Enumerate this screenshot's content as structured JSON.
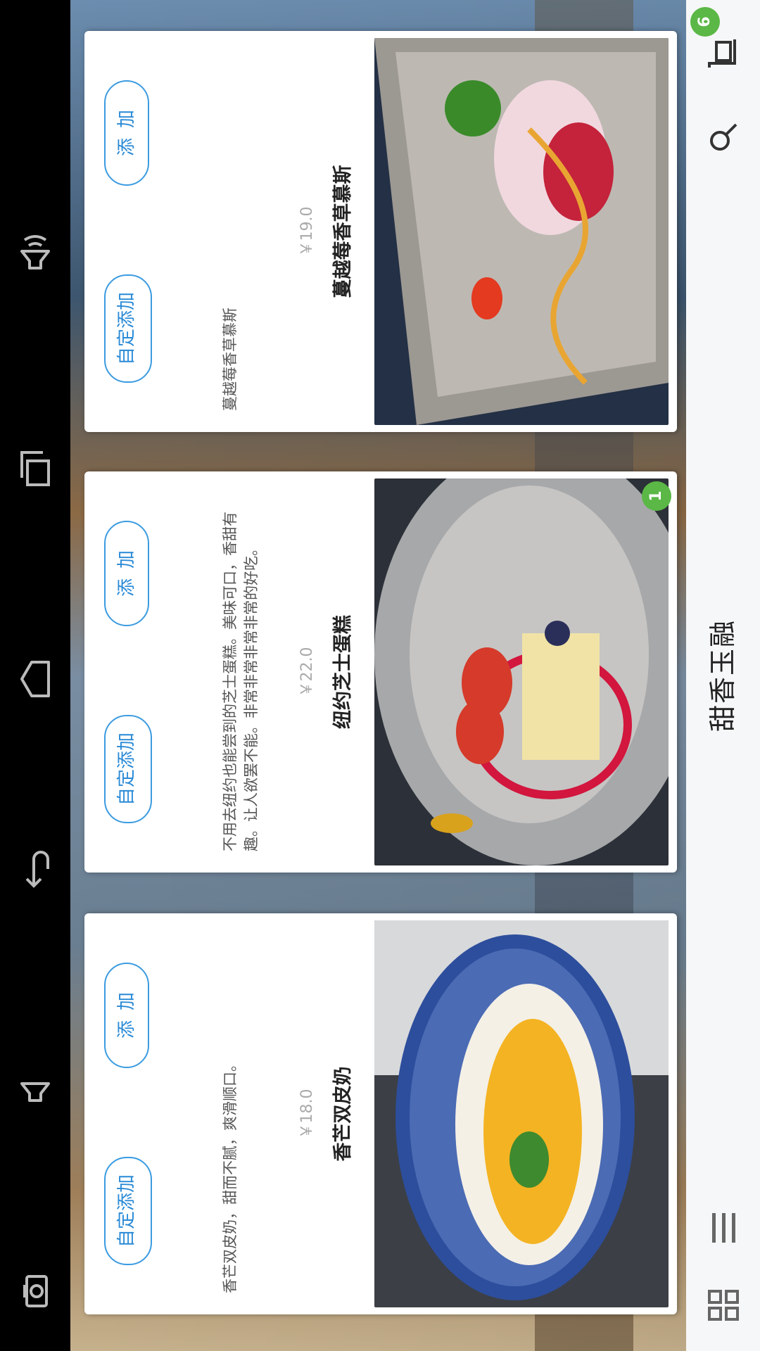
{
  "app": {
    "title": "甜香玉融",
    "cart_count": "6"
  },
  "products": [
    {
      "name": "香芒双皮奶",
      "price": "￥18.0",
      "description": "香芒双皮奶，甜而不腻，爽滑顺口。",
      "custom_button": "自定添加",
      "add_button": "添加",
      "badge": ""
    },
    {
      "name": "纽约芝士蛋糕",
      "price": "￥22.0",
      "description": "不用去纽约也能尝到的芝士蛋糕。美味可口，香甜有趣。让人欲罢不能。非常非常非常非常的好吃。",
      "custom_button": "自定添加",
      "add_button": "添加",
      "badge": "1"
    },
    {
      "name": "蔓越莓香草慕斯",
      "price": "￥19.0",
      "description": "蔓越莓香草慕斯",
      "custom_button": "自定添加",
      "add_button": "添加",
      "badge": ""
    }
  ],
  "icons": {
    "grid": "grid-icon",
    "menu": "menu-icon",
    "search": "search-icon",
    "cart": "cart-icon",
    "nav": [
      "camera-icon",
      "volume-down-icon",
      "back-icon",
      "home-icon",
      "recent-apps-icon",
      "volume-up-icon"
    ]
  },
  "colors": {
    "accent": "#3b9be0",
    "badge": "#5bb746",
    "appbar": "#f6f7f8"
  }
}
